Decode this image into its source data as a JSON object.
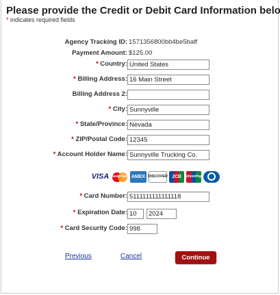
{
  "header": {
    "title": "Please provide the Credit or Debit Card Information below",
    "required_note_star": "*",
    "required_note": " indicates required fields"
  },
  "fields": {
    "tracking": {
      "label": "Agency Tracking ID:",
      "value": "1571356800bb4be5baff"
    },
    "amount": {
      "label": "Payment Amount:",
      "value": "$125.00"
    },
    "country": {
      "star": "*",
      "label": " Country:",
      "value": "United States"
    },
    "billing1": {
      "star": "*",
      "label": " Billing Address:",
      "value": "16 Main Street"
    },
    "billing2": {
      "label": "Billing Address 2:",
      "value": ""
    },
    "city": {
      "star": "*",
      "label": " City:",
      "value": "Sunnyville"
    },
    "state": {
      "star": "*",
      "label": " State/Province:",
      "value": "Nevada"
    },
    "zip": {
      "star": "*",
      "label": " ZIP/Postal Code:",
      "value": "12345"
    },
    "holder": {
      "star": "*",
      "label": " Account Holder Name:",
      "value": "Sunnyville Trucking Co."
    },
    "card_number": {
      "star": "*",
      "label": " Card Number:",
      "value": "5111111111111118"
    },
    "expiration": {
      "star": "*",
      "label": " Expiration Date:",
      "month": "10",
      "year": "2024"
    },
    "security": {
      "star": "*",
      "label": " Card Security Code:",
      "value": "998"
    }
  },
  "card_logos": {
    "visa": "VISA",
    "mastercard": "MasterCard",
    "amex": "AMEX",
    "discover": "DISCOVER",
    "jcb": "JCB",
    "unionpay": "UnionPay",
    "diners": "Diners Club"
  },
  "actions": {
    "previous": "Previous",
    "cancel": "Cancel",
    "continue": "Continue"
  },
  "colors": {
    "required_star": "#cc0000",
    "continue_button": "#a50f0f",
    "link": "#1a3399"
  }
}
